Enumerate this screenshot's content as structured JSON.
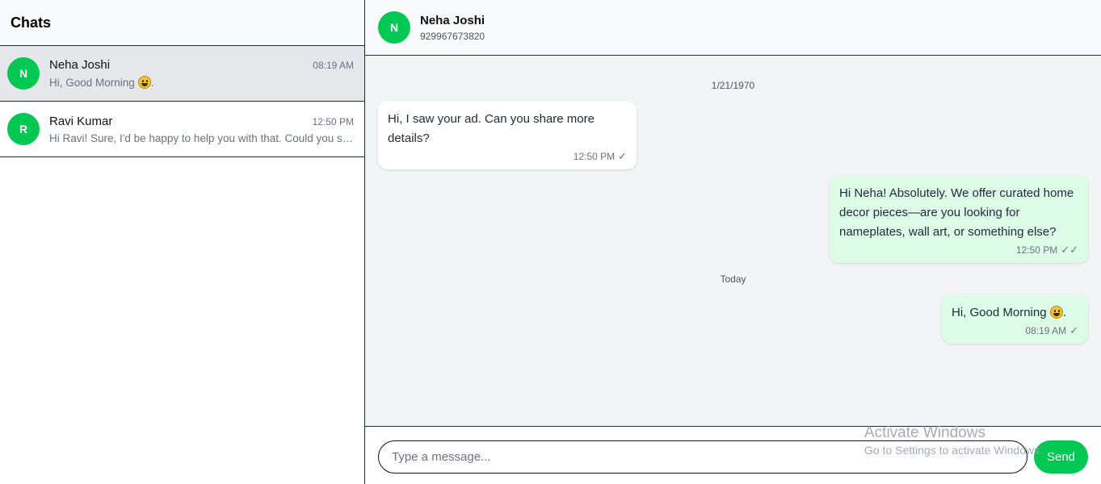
{
  "sidebar": {
    "title": "Chats",
    "chats": [
      {
        "initial": "N",
        "name": "Neha Joshi",
        "time": "08:19 AM",
        "preview": "Hi, Good Morning",
        "preview_suffix": ".",
        "active": true
      },
      {
        "initial": "R",
        "name": "Ravi Kumar",
        "time": "12:50 PM",
        "preview": "Hi Ravi! Sure, I'd be happy to help you with that. Could you share more details?",
        "active": false
      }
    ]
  },
  "conversation": {
    "header": {
      "initial": "N",
      "name": "Neha Joshi",
      "phone": "929967673820"
    },
    "date_separators": [
      "1/21/1970",
      "Today"
    ],
    "messages": [
      {
        "direction": "in",
        "text": "Hi, I saw your ad. Can you share more details?",
        "time": "12:50 PM",
        "status": "sent"
      },
      {
        "direction": "out",
        "text": "Hi Neha! Absolutely. We offer curated home decor pieces—are you looking for nameplates, wall art, or something else?",
        "time": "12:50 PM",
        "status": "delivered"
      },
      {
        "direction": "out",
        "text": "Hi, Good Morning",
        "text_suffix": ".",
        "time": "08:19 AM",
        "status": "sent"
      }
    ]
  },
  "composer": {
    "placeholder": "Type a message...",
    "send_label": "Send"
  },
  "watermark": {
    "title": "Activate Windows",
    "subtitle": "Go to Settings to activate Windows."
  },
  "colors": {
    "accent": "#00c853",
    "outgoing_bubble": "#dcfce7",
    "chat_bg": "#f3f4f6",
    "active_chat": "#e5e7eb"
  },
  "icons": {
    "sent": "check-icon",
    "delivered": "double-check-icon",
    "emoji": "grinning-face-emoji"
  }
}
